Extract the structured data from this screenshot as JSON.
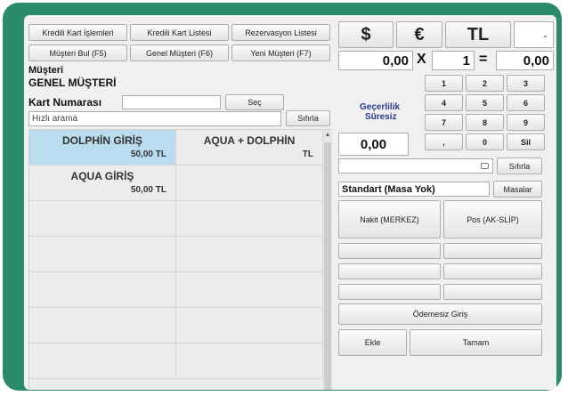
{
  "top_buttons": {
    "credit_card_ops": "Kredili Kart İşlemleri",
    "credit_card_list": "Kredili Kart Listesi",
    "reservation_list": "Rezervasyon Listesi",
    "find_customer": "Müşteri Bul (F5)",
    "general_customer": "Genel Müşteri (F6)",
    "new_customer": "Yeni Müşteri (F7)"
  },
  "customer": {
    "label": "Müşteri",
    "name": "GENEL MÜŞTERİ",
    "card_number_label": "Kart Numarası",
    "card_number_value": "",
    "select_button": "Seç",
    "search_placeholder": "Hızlı arama",
    "reset_button": "Sıfırla"
  },
  "products": [
    {
      "name": "DOLPHİN GİRİŞ",
      "price": "50,00  TL",
      "selected": true
    },
    {
      "name": "AQUA + DOLPHİN",
      "price": "TL",
      "selected": false
    },
    {
      "name": "AQUA GİRİŞ",
      "price": "50,00  TL",
      "selected": false
    },
    {
      "name": "",
      "price": "",
      "selected": false
    },
    {
      "name": "",
      "price": "",
      "selected": false
    },
    {
      "name": "",
      "price": "",
      "selected": false
    },
    {
      "name": "",
      "price": "",
      "selected": false
    },
    {
      "name": "",
      "price": "",
      "selected": false
    },
    {
      "name": "",
      "price": "",
      "selected": false
    },
    {
      "name": "",
      "price": "",
      "selected": false
    },
    {
      "name": "",
      "price": "",
      "selected": false
    },
    {
      "name": "",
      "price": "",
      "selected": false
    },
    {
      "name": "",
      "price": "",
      "selected": false
    },
    {
      "name": "",
      "price": "",
      "selected": false
    }
  ],
  "currency": {
    "dollar": "$",
    "euro": "€",
    "lira": "TL",
    "dropdown_value": ""
  },
  "calc": {
    "amount": "0,00",
    "times": "X",
    "quantity": "1",
    "equals": "=",
    "total": "0,00",
    "validity_label_1": "Geçerlilik",
    "validity_label_2": "Süresiz",
    "entry": "0,00",
    "keys": [
      "1",
      "2",
      "3",
      "4",
      "5",
      "6",
      "7",
      "8",
      "9",
      ",",
      "0",
      "Sil"
    ]
  },
  "note": {
    "value": "",
    "reset_button": "Sıfırla"
  },
  "table": {
    "name": "Standart (Masa Yok)",
    "tables_button": "Masalar"
  },
  "payment": {
    "cash": "Nakit (MERKEZ)",
    "pos": "Pos (AK-SLİP)",
    "unpaid_entry": "Ödemesiz Giriş",
    "add": "Ekle",
    "ok": "Tamam"
  },
  "colors": {
    "frame": "#2c8a6c",
    "selected_cell": "#b9dcef",
    "validity_text": "#2a3a8c"
  }
}
